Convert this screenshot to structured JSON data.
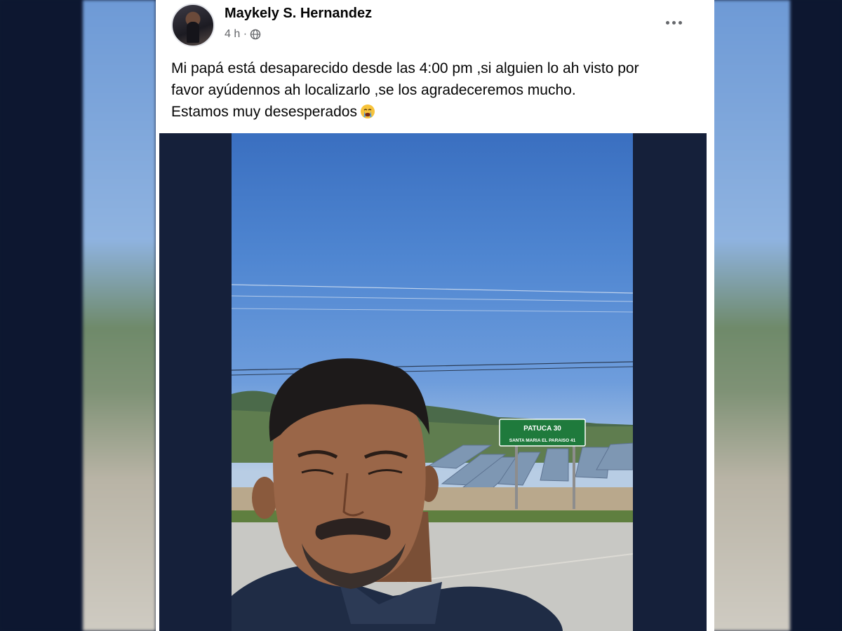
{
  "post": {
    "author": "Maykely S. Hernandez",
    "time": "4 h ·",
    "privacy_icon": "globe-icon",
    "menu_icon": "more-options-icon",
    "text_lines": [
      "Mi papá está desaparecido desde las 4:00 pm ,si alguien lo ah visto por",
      "favor ayúdennos ah localizarlo ,se los agradeceremos mucho.",
      "Estamos muy desesperados"
    ],
    "emoji": "crying-face-icon"
  },
  "photo": {
    "sign_line_1": "PATUCA 30",
    "sign_line_2": "SANTA MARIA EL PARAISO 41"
  },
  "colors": {
    "card_bg": "#ffffff",
    "text": "#050505",
    "meta": "#65676b",
    "sign_green": "#1f7a3c",
    "photo_frame": "#15203a"
  }
}
